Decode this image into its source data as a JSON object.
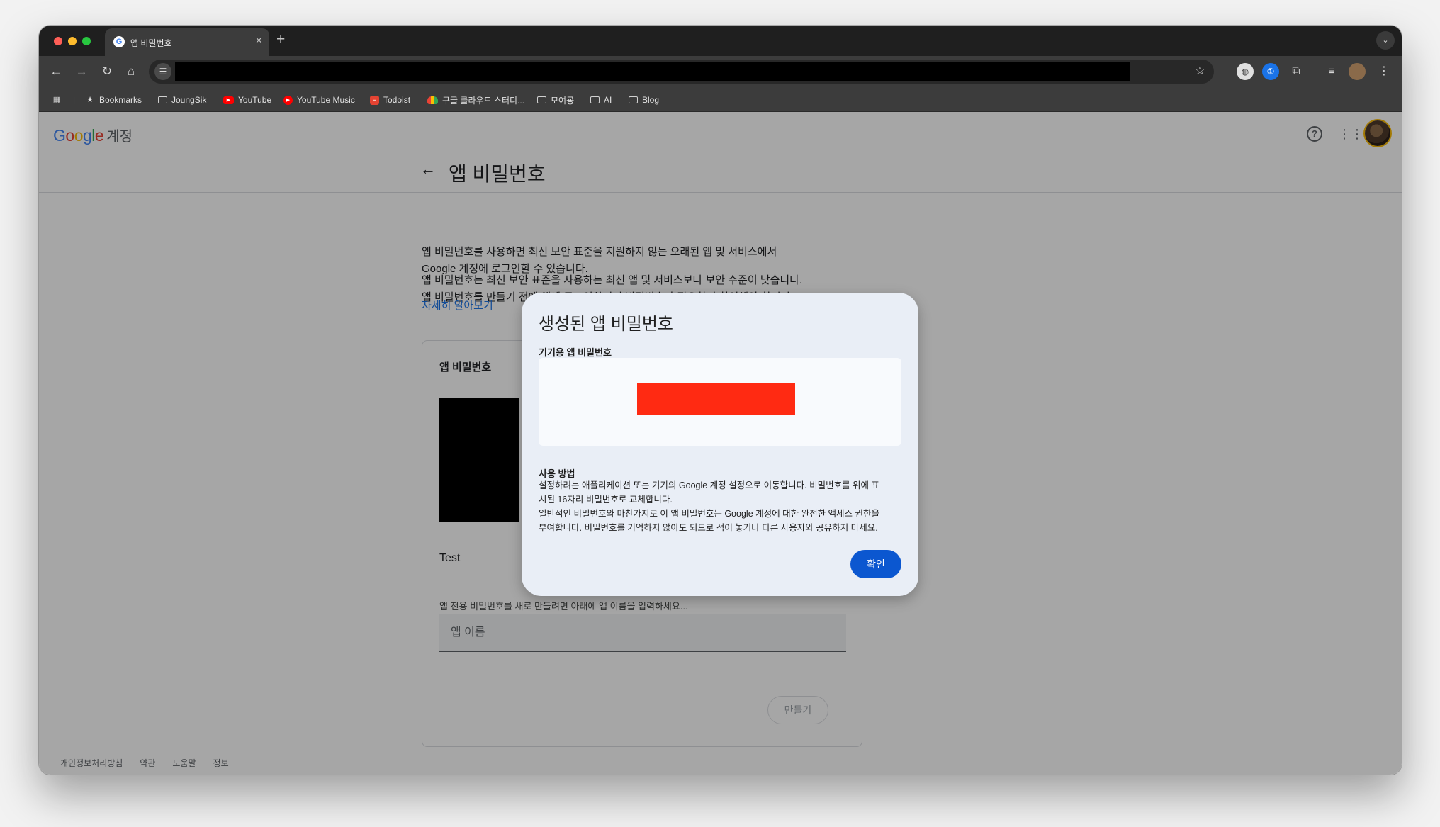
{
  "browser": {
    "tab_title": "앱 비밀번호",
    "tab_favicon": "G",
    "new_tab": "+",
    "omnibox": {
      "redacted": true
    },
    "bookmarks": [
      {
        "label": "Bookmarks",
        "icon": "star-icon"
      },
      {
        "label": "JoungSik",
        "icon": "folder-icon"
      },
      {
        "label": "YouTube",
        "icon": "youtube-icon"
      },
      {
        "label": "YouTube Music",
        "icon": "youtube-music-icon"
      },
      {
        "label": "Todoist",
        "icon": "todoist-icon"
      },
      {
        "label": "구글 클라우드 스터디...",
        "icon": "google-cloud-icon"
      },
      {
        "label": "모여굥",
        "icon": "folder-icon"
      },
      {
        "label": "AI",
        "icon": "folder-icon"
      },
      {
        "label": "Blog",
        "icon": "folder-icon"
      }
    ],
    "traffic_light_colors": [
      "#ff5f57",
      "#febc2e",
      "#28c840"
    ]
  },
  "header": {
    "logo_google": "Google",
    "logo_account": "계정",
    "icons": [
      "help-icon",
      "apps-grid-icon",
      "avatar"
    ]
  },
  "page": {
    "title": "앱 비밀번호",
    "description_1_line1": "앱 비밀번호를 사용하면 최신 보안 표준을 지원하지 않는 오래된 앱 및 서비스에서",
    "description_1_line2": "Google 계정에 로그인할 수 있습니다.",
    "description_2_line1": "앱 비밀번호는 최신 보안 표준을 사용하는 최신 앱 및 서비스보다 보안 수준이 낮습니다.",
    "description_2_line2": "앱 비밀번호를 만들기 전에 앱에 로그인하려면 비밀번호가 필요한지 확인해야 합니다.",
    "learn_more": "자세히 알아보기"
  },
  "card": {
    "title": "앱 비밀번호",
    "app_name": "Test",
    "helper_text": "앱 전용 비밀번호를 새로 만들려면 아래에 앱 이름을 입력하세요...",
    "input_placeholder": "앱 이름",
    "create_button": "만들기"
  },
  "footer": {
    "links": [
      "개인정보처리방침",
      "약관",
      "도움말",
      "정보"
    ]
  },
  "dialog": {
    "title": "생성된 앱 비밀번호",
    "subtitle": "기기용 앱 비밀번호",
    "password_redacted": true,
    "usage_title": "사용 방법",
    "usage_line1": "설정하려는 애플리케이션 또는 기기의 Google 계정 설정으로 이동합니다. 비밀번호를 위에 표",
    "usage_line2": "시된 16자리 비밀번호로 교체합니다.",
    "usage_line3": "일반적인 비밀번호와 마찬가지로 이 앱 비밀번호는 Google 계정에 대한 완전한 액세스 권한을",
    "usage_line4": "부여합니다. 비밀번호를 기억하지 않아도 되므로 적어 놓거나 다른 사용자와 공유하지 마세요.",
    "ok_button": "확인",
    "accent_color": "#0b57d0"
  }
}
